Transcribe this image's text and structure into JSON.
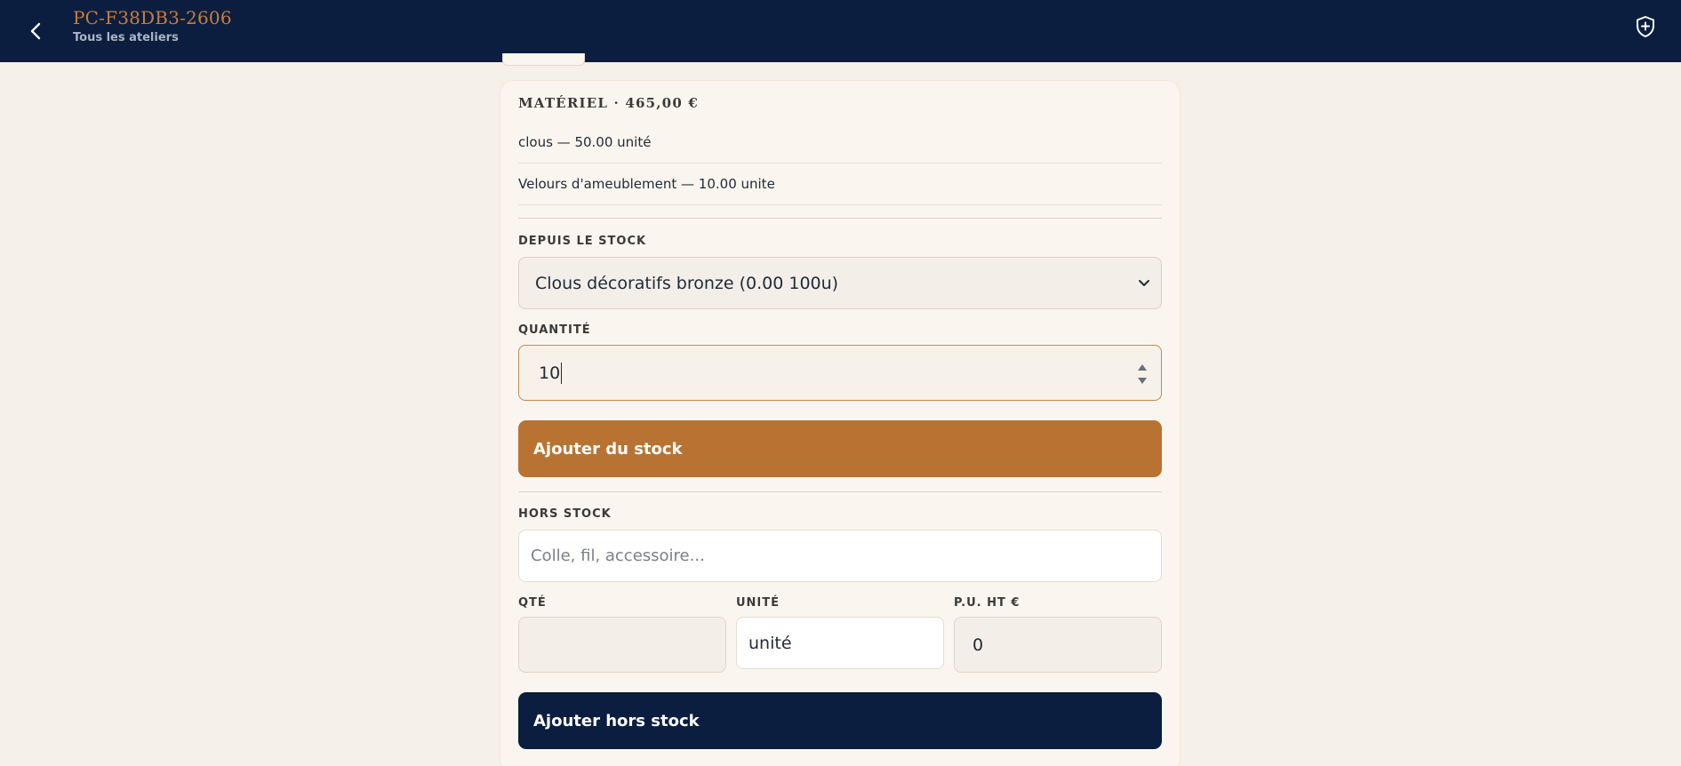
{
  "header": {
    "title": "PC-F38DB3-2606",
    "subtitle": "Tous les ateliers",
    "back_icon": "chevron-left-icon",
    "action_icon": "shield-plus-icon"
  },
  "materiel": {
    "title": "MATÉRIEL · 465,00 €",
    "items": [
      "clous — 50.00 unité",
      "Velours d'ameublement — 10.00 unite"
    ]
  },
  "stock": {
    "label": "DEPUIS LE STOCK",
    "selected": "Clous décoratifs bronze (0.00 100u)",
    "quantity_label": "QUANTITÉ",
    "quantity_value": "10",
    "add_button": "Ajouter du stock"
  },
  "hors_stock": {
    "label": "HORS STOCK",
    "placeholder": "Colle, fil, accessoire...",
    "qty_label": "QTÉ",
    "qty_value": "",
    "unit_label": "UNITÉ",
    "unit_value": "unité",
    "price_label": "P.U. HT €",
    "price_value": "0",
    "add_button": "Ajouter hors stock"
  },
  "colors": {
    "navy": "#0b1e3f",
    "copper": "#b87333",
    "background": "#f5f0e8"
  }
}
